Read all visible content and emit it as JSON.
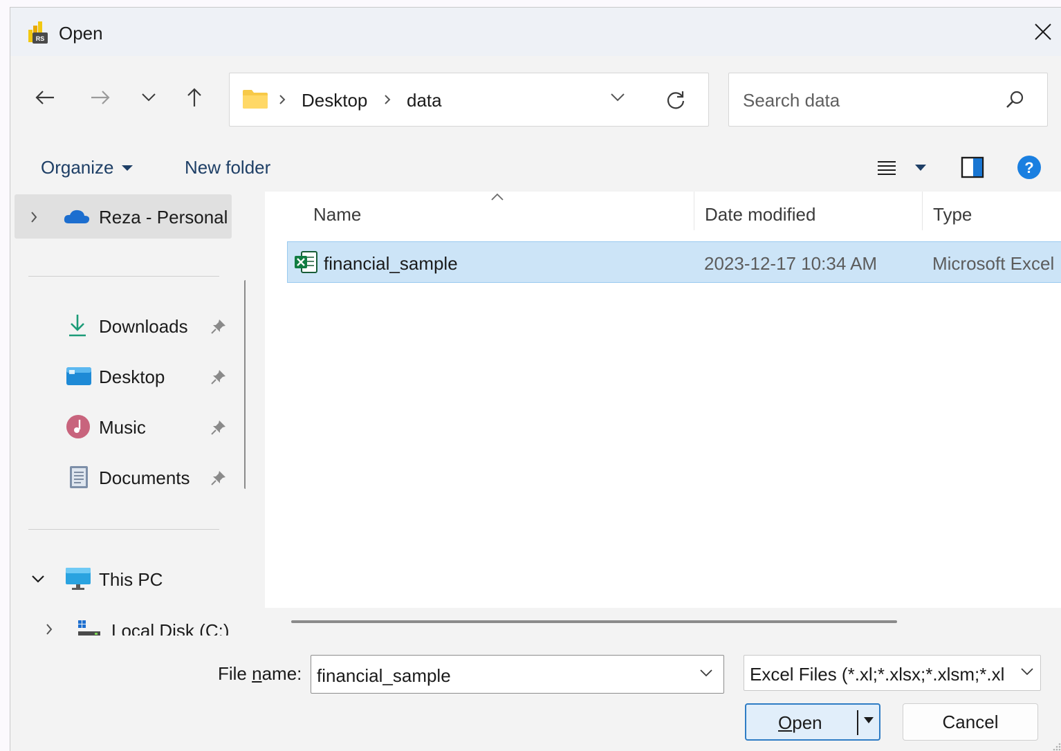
{
  "window": {
    "title": "Open"
  },
  "nav": {
    "breadcrumbs": [
      "Desktop",
      "data"
    ],
    "search_placeholder": "Search data"
  },
  "toolbar": {
    "organize_label": "Organize",
    "new_folder_label": "New folder"
  },
  "sidebar": {
    "onedrive_label": "Reza - Personal",
    "quick_access": [
      {
        "label": "Downloads",
        "icon": "download-icon"
      },
      {
        "label": "Desktop",
        "icon": "desktop-folder-icon"
      },
      {
        "label": "Music",
        "icon": "music-icon"
      },
      {
        "label": "Documents",
        "icon": "documents-icon"
      }
    ],
    "this_pc_label": "This PC",
    "local_disk_label": "Local Disk (C:)"
  },
  "file_list": {
    "columns": [
      "Name",
      "Date modified",
      "Type"
    ],
    "rows": [
      {
        "name": "financial_sample",
        "date": "2023-12-17 10:34 AM",
        "type": "Microsoft Excel",
        "icon": "excel-file-icon"
      }
    ]
  },
  "footer": {
    "file_name_label_pre": "File ",
    "file_name_label_u": "n",
    "file_name_label_post": "ame:",
    "file_name_value": "financial_sample",
    "file_type_value": "Excel Files (*.xl;*.xlsx;*.xlsm;*.xl",
    "open_label_u": "O",
    "open_label_rest": "pen",
    "cancel_label": "Cancel"
  },
  "colors": {
    "selection": "#cce4f7",
    "accent": "#2e7cc4",
    "link_text": "#1e3f66"
  }
}
